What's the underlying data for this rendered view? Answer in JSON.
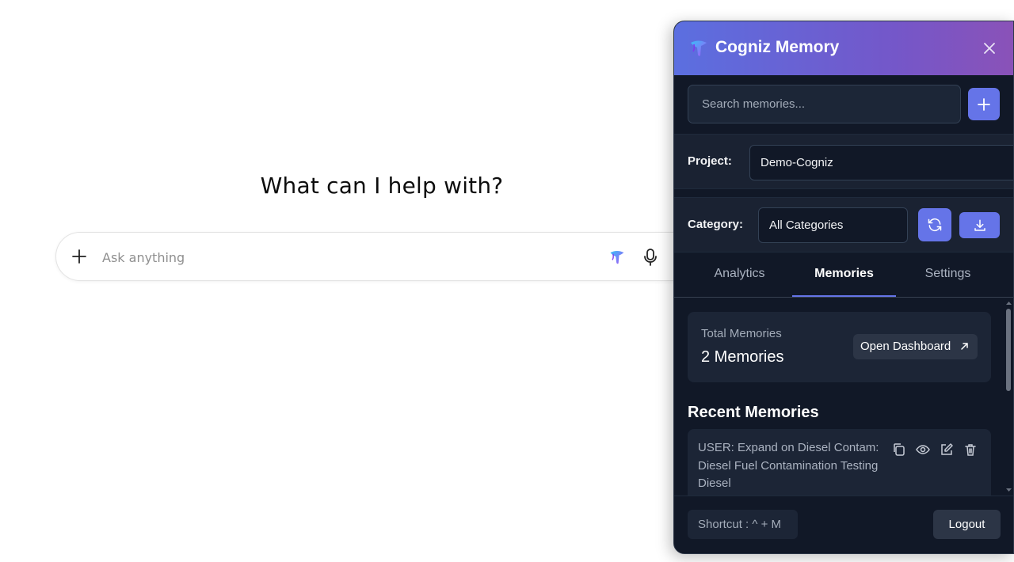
{
  "chat": {
    "heading": "What can I help with?",
    "input_placeholder": "Ask anything"
  },
  "panel": {
    "title": "Cogniz Memory",
    "search_placeholder": "Search memories...",
    "project_label": "Project:",
    "project_value": "Demo-Cogniz",
    "category_label": "Category:",
    "category_value": "All Categories",
    "tabs": [
      {
        "label": "Analytics",
        "active": false
      },
      {
        "label": "Memories",
        "active": true
      },
      {
        "label": "Settings",
        "active": false
      }
    ],
    "stats": {
      "label": "Total Memories",
      "count": "2 Memories",
      "dashboard_button": "Open Dashboard"
    },
    "recent_title": "Recent Memories",
    "memories": [
      {
        "text": "USER: Expand on Diesel Contam: Diesel Fuel Contamination Testing Diesel",
        "actions": [
          "copy-icon",
          "eye-icon",
          "edit-icon",
          "trash-icon"
        ]
      }
    ],
    "shortcut": "Shortcut : ^ + M",
    "logout_label": "Logout"
  },
  "colors": {
    "accent": "#6574e8",
    "panel_bg": "#111827",
    "header_gradient_start": "#5b6fe0",
    "header_gradient_end": "#8a52b8"
  }
}
